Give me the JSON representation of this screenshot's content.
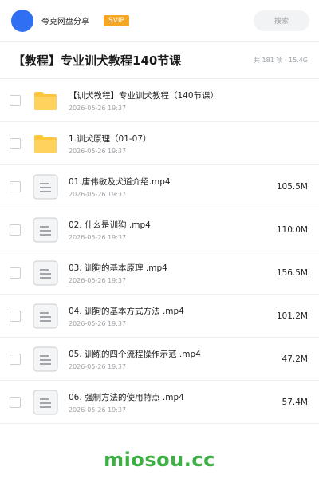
{
  "header": {
    "brand": "夸克网盘分享",
    "badge": "SVIP",
    "search_label": "搜索"
  },
  "title_bar": {
    "title": "【教程】专业训犬教程140节课",
    "meta": "共 181 项 · 15.4G"
  },
  "files": [
    {
      "type": "folder",
      "name": "【训犬教程】专业训犬教程（140节课）",
      "date": "2026-05-26 19:37",
      "size": ""
    },
    {
      "type": "folder",
      "name": "1.训犬原理（01-07）",
      "date": "2026-05-26 19:37",
      "size": ""
    },
    {
      "type": "file",
      "name": "01.唐伟敏及犬道介绍.mp4",
      "date": "2026-05-26 19:37",
      "size": "105.5M"
    },
    {
      "type": "file",
      "name": "02. 什么是训狗 .mp4",
      "date": "2026-05-26 19:37",
      "size": "110.0M"
    },
    {
      "type": "file",
      "name": "03. 训狗的基本原理 .mp4",
      "date": "2026-05-26 19:37",
      "size": "156.5M"
    },
    {
      "type": "file",
      "name": "04. 训狗的基本方式方法 .mp4",
      "date": "2026-05-26 19:37",
      "size": "101.2M"
    },
    {
      "type": "file",
      "name": "05. 训练的四个流程操作示范 .mp4",
      "date": "2026-05-26 19:37",
      "size": "47.2M"
    },
    {
      "type": "file",
      "name": "06. 强制方法的使用特点 .mp4",
      "date": "2026-05-26 19:37",
      "size": "57.4M"
    }
  ],
  "watermark": "miosou.cc",
  "colors": {
    "avatar": "#2f6ff2",
    "badge": "#f5a623",
    "folder": "#ffc53d",
    "watermark": "#3cb043"
  }
}
